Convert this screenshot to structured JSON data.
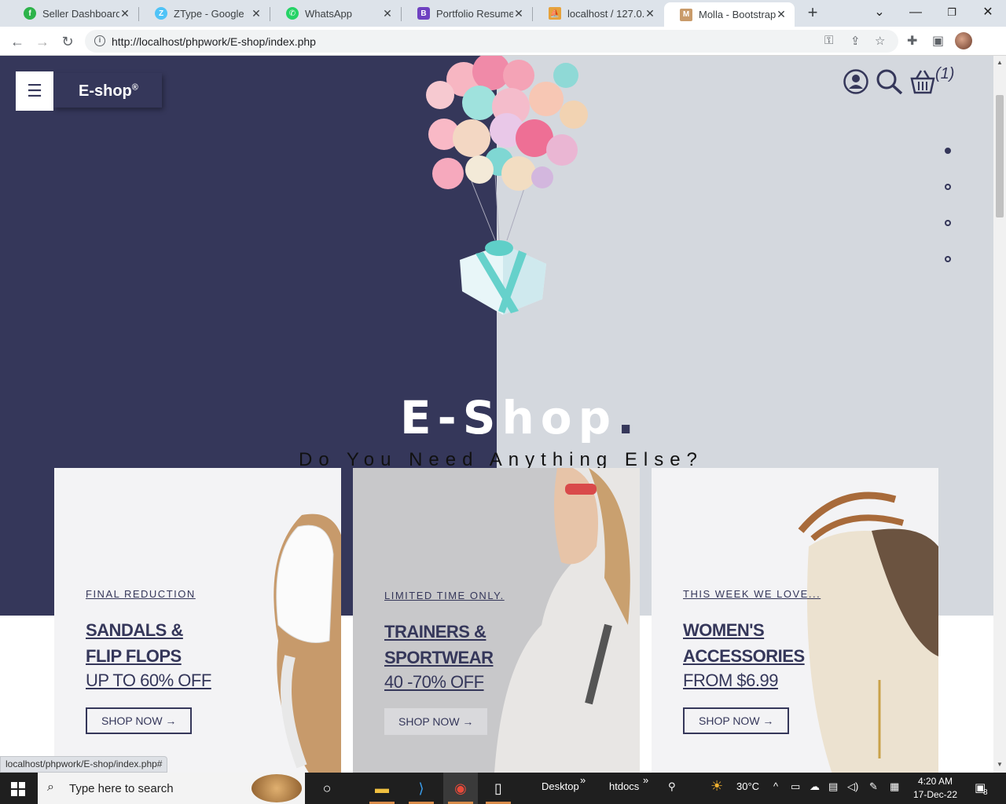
{
  "browser": {
    "tabs": [
      {
        "title": "Seller Dashboard",
        "favicon": "flipkart-seller-icon",
        "color": "#2db34a"
      },
      {
        "title": "ZType - Google",
        "favicon": "ztype-icon",
        "color": "#4fc3f7"
      },
      {
        "title": "WhatsApp",
        "favicon": "whatsapp-icon",
        "color": "#25d366"
      },
      {
        "title": "Portfolio Resume -",
        "favicon": "bootstrap-icon",
        "color": "#6f42c1"
      },
      {
        "title": "localhost / 127.0.0.",
        "favicon": "phpmyadmin-icon",
        "color": "#e6a23c"
      },
      {
        "title": "Molla - Bootstrap e",
        "favicon": "molla-icon",
        "color": "#c99b6a"
      }
    ],
    "url": "http://localhost/phpwork/E-shop/index.php",
    "status_url": "localhost/phpwork/E-shop/index.php#"
  },
  "site": {
    "logo": "E-shop",
    "logo_mark": "®",
    "cart_count": "(1)",
    "hero_title": "E-Shop",
    "hero_title_dot": ".",
    "hero_subtitle": "Do You Need Anything Else?",
    "slides_count": 4,
    "active_slide": 1,
    "colors": {
      "navy": "#35375a",
      "light": "#d4d8de"
    }
  },
  "promos": [
    {
      "kicker": "FINAL REDUCTION",
      "head1": "SANDALS &",
      "head2": "FLIP FLOPS",
      "offer": "UP TO 60% OFF",
      "button": "SHOP NOW  →"
    },
    {
      "kicker": "LIMITED TIME ONLY.",
      "head1": "TRAINERS &",
      "head2": "SPORTWEAR",
      "offer": "40 -70% OFF",
      "button": "SHOP NOW  →"
    },
    {
      "kicker": "THIS WEEK WE LOVE...",
      "head1": "WOMEN'S",
      "head2": "ACCESSORIES",
      "offer": "FROM $6.99",
      "button": "SHOP NOW  →"
    }
  ],
  "taskbar": {
    "search_placeholder": "Type here to search",
    "desktop_label": "Desktop",
    "htdocs_label": "htdocs",
    "temperature": "30°C",
    "time": "4:20 AM",
    "date": "17-Dec-22",
    "notifications": "8"
  }
}
